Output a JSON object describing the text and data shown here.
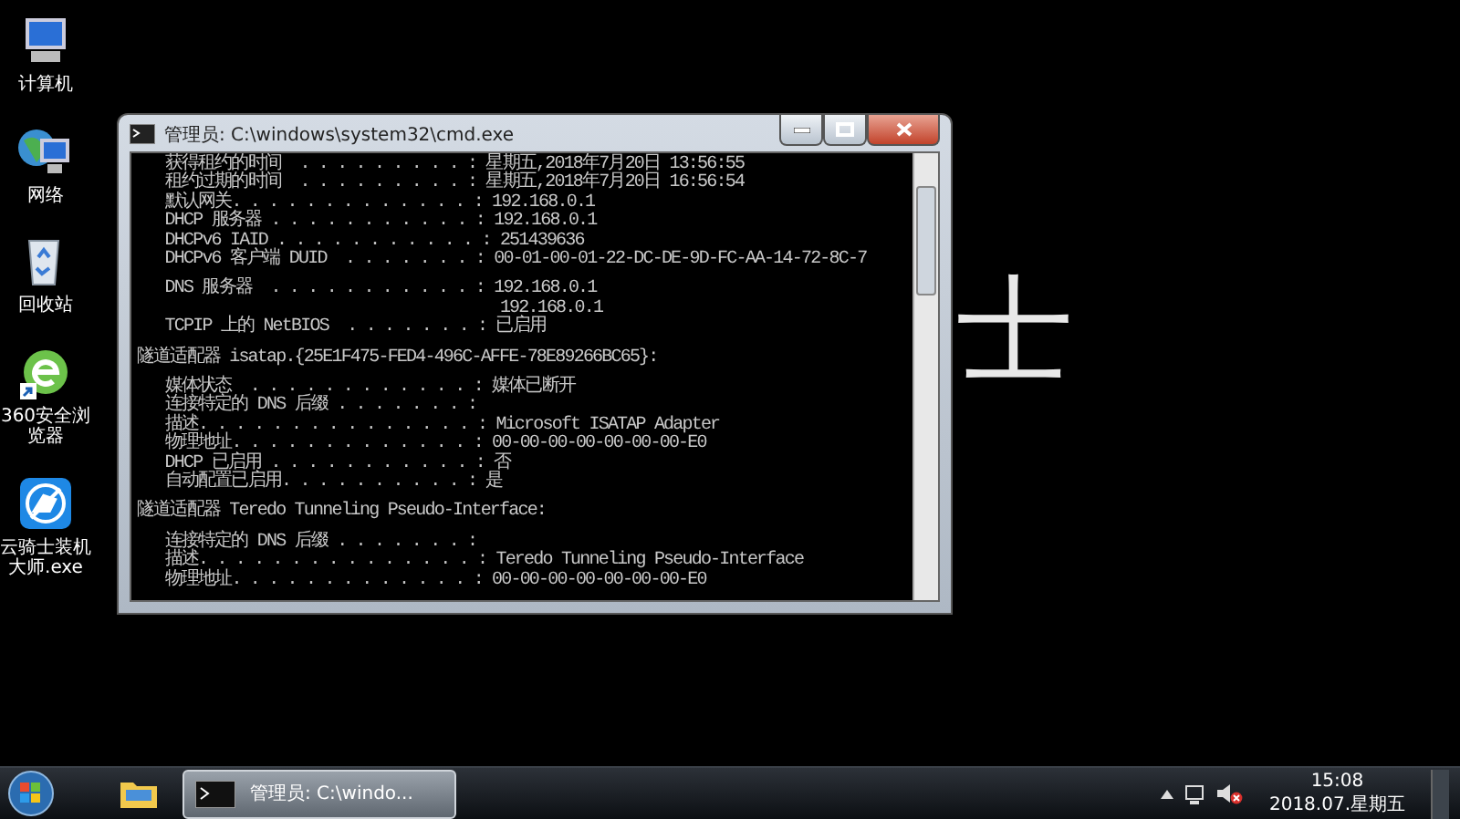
{
  "desktop": {
    "wallpaper_text": "士",
    "icons": [
      {
        "kind": "computer",
        "label": "计算机"
      },
      {
        "kind": "network",
        "label": "网络"
      },
      {
        "kind": "recycle",
        "label": "回收站"
      },
      {
        "kind": "browser",
        "label": "360安全浏览器"
      },
      {
        "kind": "installer",
        "label": "云骑士装机大师.exe"
      }
    ]
  },
  "window": {
    "title": "管理员: C:\\windows\\system32\\cmd.exe",
    "blocks": [
      [
        "   获得租约的时间  . . . . . . . . . : 星期五,2018年7月20日 13:56:55",
        "   租约过期的时间  . . . . . . . . . : 星期五,2018年7月20日 16:56:54",
        "   默认网关. . . . . . . . . . . . . : 192.168.0.1",
        "   DHCP 服务器 . . . . . . . . . . . : 192.168.0.1",
        "   DHCPv6 IAID . . . . . . . . . . . : 251439636",
        "   DHCPv6 客户端 DUID  . . . . . . . : 00-01-00-01-22-DC-DE-9D-FC-AA-14-72-8C-7"
      ],
      [
        "   DNS 服务器  . . . . . . . . . . . : 192.168.0.1",
        "                                       192.168.0.1",
        "   TCPIP 上的 NetBIOS  . . . . . . . : 已启用"
      ],
      [
        "隧道适配器 isatap.{25E1F475-FED4-496C-AFFE-78E89266BC65}:"
      ],
      [
        "   媒体状态  . . . . . . . . . . . . : 媒体已断开",
        "   连接特定的 DNS 后缀 . . . . . . . :",
        "   描述. . . . . . . . . . . . . . . : Microsoft ISATAP Adapter",
        "   物理地址. . . . . . . . . . . . . : 00-00-00-00-00-00-00-E0",
        "   DHCP 已启用 . . . . . . . . . . . : 否",
        "   自动配置已启用. . . . . . . . . . : 是"
      ],
      [
        "隧道适配器 Teredo Tunneling Pseudo-Interface:"
      ],
      [
        "   连接特定的 DNS 后缀 . . . . . . . :",
        "   描述. . . . . . . . . . . . . . . : Teredo Tunneling Pseudo-Interface",
        "   物理地址. . . . . . . . . . . . . : 00-00-00-00-00-00-00-E0"
      ]
    ]
  },
  "taskbar": {
    "tasks": [
      {
        "kind": "explorer",
        "selected": false
      },
      {
        "kind": "cmd",
        "label": "管理员: C:\\windo...",
        "selected": true
      }
    ],
    "clock": {
      "time": "15:08",
      "date": "2018.07.星期五"
    }
  }
}
